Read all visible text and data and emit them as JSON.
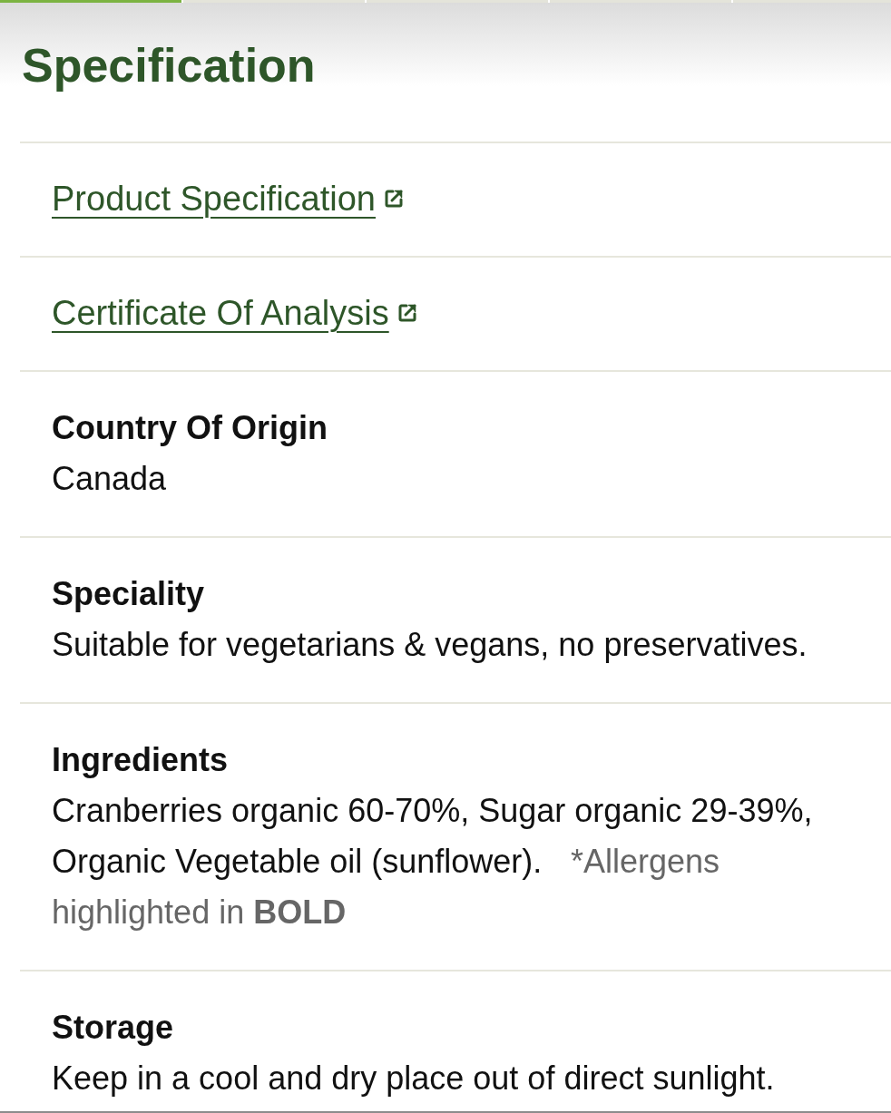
{
  "indicator": {
    "segments": [
      {
        "selected": true
      },
      {
        "selected": false
      },
      {
        "selected": false
      },
      {
        "selected": false
      },
      {
        "selected": false
      }
    ]
  },
  "section": {
    "title": "Specification"
  },
  "links": [
    {
      "label": "Product Specification"
    },
    {
      "label": "Certificate Of Analysis"
    }
  ],
  "details": [
    {
      "label": "Country Of Origin",
      "value": "Canada"
    },
    {
      "label": "Speciality",
      "value": "Suitable for vegetarians & vegans, no preservatives."
    },
    {
      "label": "Ingredients",
      "value": "Cranberries organic 60-70%, Sugar organic 29-39%, Organic Vegetable oil (sunflower).",
      "note": "*Allergens highlighted in **BOLD**"
    },
    {
      "label": "Storage",
      "value": "Keep in a cool and dry place out of direct sunlight."
    }
  ]
}
